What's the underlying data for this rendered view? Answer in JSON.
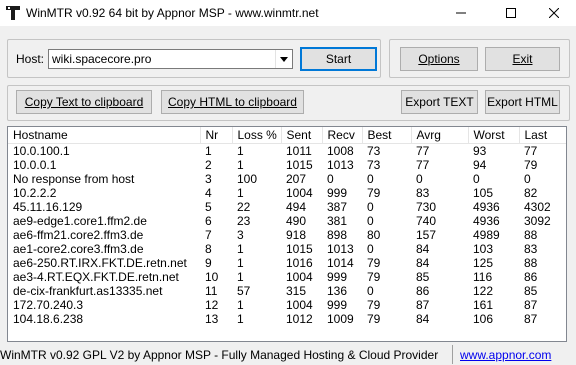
{
  "window": {
    "title": "WinMTR v0.92 64 bit by Appnor MSP - www.winmtr.net"
  },
  "host": {
    "label": "Host:",
    "value": "wiki.spacecore.pro"
  },
  "buttons": {
    "start": "Start",
    "options": "Options",
    "exit": "Exit",
    "copy_text": "Copy Text to clipboard",
    "copy_html": "Copy HTML to clipboard",
    "export_text": "Export TEXT",
    "export_html": "Export HTML"
  },
  "table": {
    "columns": [
      "Hostname",
      "Nr",
      "Loss %",
      "Sent",
      "Recv",
      "Best",
      "Avrg",
      "Worst",
      "Last"
    ],
    "rows": [
      [
        "10.0.100.1",
        "1",
        "1",
        "1011",
        "1008",
        "73",
        "77",
        "93",
        "77"
      ],
      [
        "10.0.0.1",
        "2",
        "1",
        "1015",
        "1013",
        "73",
        "77",
        "94",
        "79"
      ],
      [
        "No response from host",
        "3",
        "100",
        "207",
        "0",
        "0",
        "0",
        "0",
        "0"
      ],
      [
        "10.2.2.2",
        "4",
        "1",
        "1004",
        "999",
        "79",
        "83",
        "105",
        "82"
      ],
      [
        "45.11.16.129",
        "5",
        "22",
        "494",
        "387",
        "0",
        "730",
        "4936",
        "4302"
      ],
      [
        "ae9-edge1.core1.ffm2.de",
        "6",
        "23",
        "490",
        "381",
        "0",
        "740",
        "4936",
        "3092"
      ],
      [
        "ae6-ffm21.core2.ffm3.de",
        "7",
        "3",
        "918",
        "898",
        "80",
        "157",
        "4989",
        "88"
      ],
      [
        "ae1-core2.core3.ffm3.de",
        "8",
        "1",
        "1015",
        "1013",
        "0",
        "84",
        "103",
        "83"
      ],
      [
        "ae6-250.RT.IRX.FKT.DE.retn.net",
        "9",
        "1",
        "1016",
        "1014",
        "79",
        "84",
        "125",
        "88"
      ],
      [
        "ae3-4.RT.EQX.FKT.DE.retn.net",
        "10",
        "1",
        "1004",
        "999",
        "79",
        "85",
        "116",
        "86"
      ],
      [
        "de-cix-frankfurt.as13335.net",
        "11",
        "57",
        "315",
        "136",
        "0",
        "86",
        "122",
        "85"
      ],
      [
        "172.70.240.3",
        "12",
        "1",
        "1004",
        "999",
        "79",
        "87",
        "161",
        "87"
      ],
      [
        "104.18.6.238",
        "13",
        "1",
        "1012",
        "1009",
        "79",
        "84",
        "106",
        "87"
      ]
    ]
  },
  "status": {
    "text": "WinMTR v0.92 GPL V2 by Appnor MSP - Fully Managed Hosting & Cloud Provider",
    "link": "www.appnor.com"
  }
}
